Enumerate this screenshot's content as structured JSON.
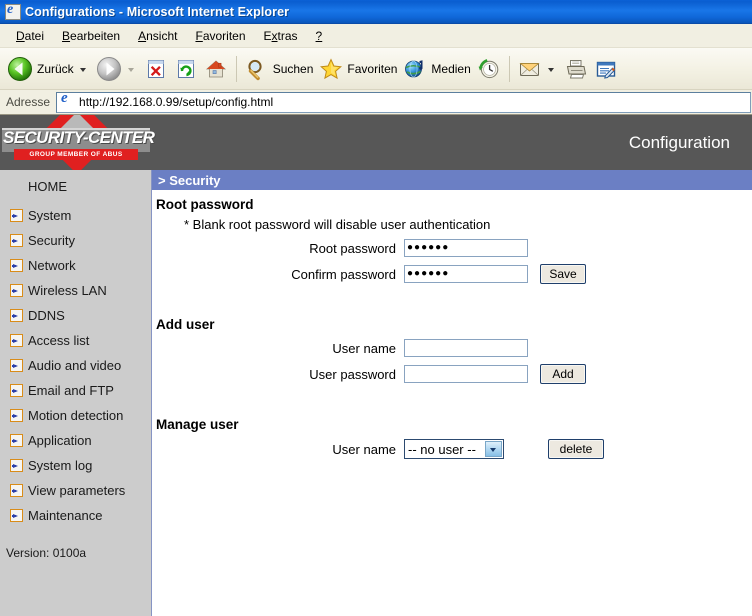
{
  "window": {
    "title": "Configurations - Microsoft Internet Explorer",
    "icon": "ie-document-icon"
  },
  "menubar": {
    "items": [
      {
        "label": "Datei",
        "accel": "D"
      },
      {
        "label": "Bearbeiten",
        "accel": "B"
      },
      {
        "label": "Ansicht",
        "accel": "A"
      },
      {
        "label": "Favoriten",
        "accel": "F"
      },
      {
        "label": "Extras",
        "accel": "x"
      },
      {
        "label": "?",
        "accel": ""
      }
    ]
  },
  "toolbar": {
    "back_label": "Zurück",
    "forward_label": "",
    "stop_label": "",
    "refresh_label": "",
    "home_label": "",
    "search_label": "Suchen",
    "favorites_label": "Favoriten",
    "media_label": "Medien",
    "history_label": "",
    "mail_label": "",
    "print_label": "",
    "edit_label": ""
  },
  "addressbar": {
    "label": "Adresse",
    "url": "http://192.168.0.99/setup/config.html",
    "placeholder": "http://"
  },
  "banner": {
    "logo_main": "SECURITY-CENTER",
    "logo_sub": "GROUP MEMBER OF ABUS",
    "title": "Configuration",
    "bg_color": "#575757",
    "logo_red": "#e02020"
  },
  "sidebar": {
    "home_label": "HOME",
    "items": [
      {
        "label": "System"
      },
      {
        "label": "Security"
      },
      {
        "label": "Network"
      },
      {
        "label": "Wireless LAN"
      },
      {
        "label": "DDNS"
      },
      {
        "label": "Access list"
      },
      {
        "label": "Audio and video"
      },
      {
        "label": "Email and FTP"
      },
      {
        "label": "Motion detection"
      },
      {
        "label": "Application"
      },
      {
        "label": "System log"
      },
      {
        "label": "View parameters"
      },
      {
        "label": "Maintenance"
      }
    ],
    "version": "Version: 0100a",
    "bg_color": "#cccccc",
    "arrow_border_color": "#d98c18"
  },
  "content": {
    "section_bar": "> Security",
    "section_bar_color": "#6b7fc4",
    "root_password": {
      "heading": "Root password",
      "note": "* Blank root password will disable user authentication",
      "root_label": "Root password",
      "root_value": "●●●●●●",
      "confirm_label": "Confirm password",
      "confirm_value": "●●●●●●",
      "save_label": "Save"
    },
    "add_user": {
      "heading": "Add user",
      "username_label": "User name",
      "username_value": "",
      "password_label": "User password",
      "password_value": "",
      "add_label": "Add"
    },
    "manage_user": {
      "heading": "Manage user",
      "username_label": "User name",
      "selected_option": "-- no user --",
      "options": [
        "-- no user --"
      ],
      "delete_label": "delete"
    }
  }
}
